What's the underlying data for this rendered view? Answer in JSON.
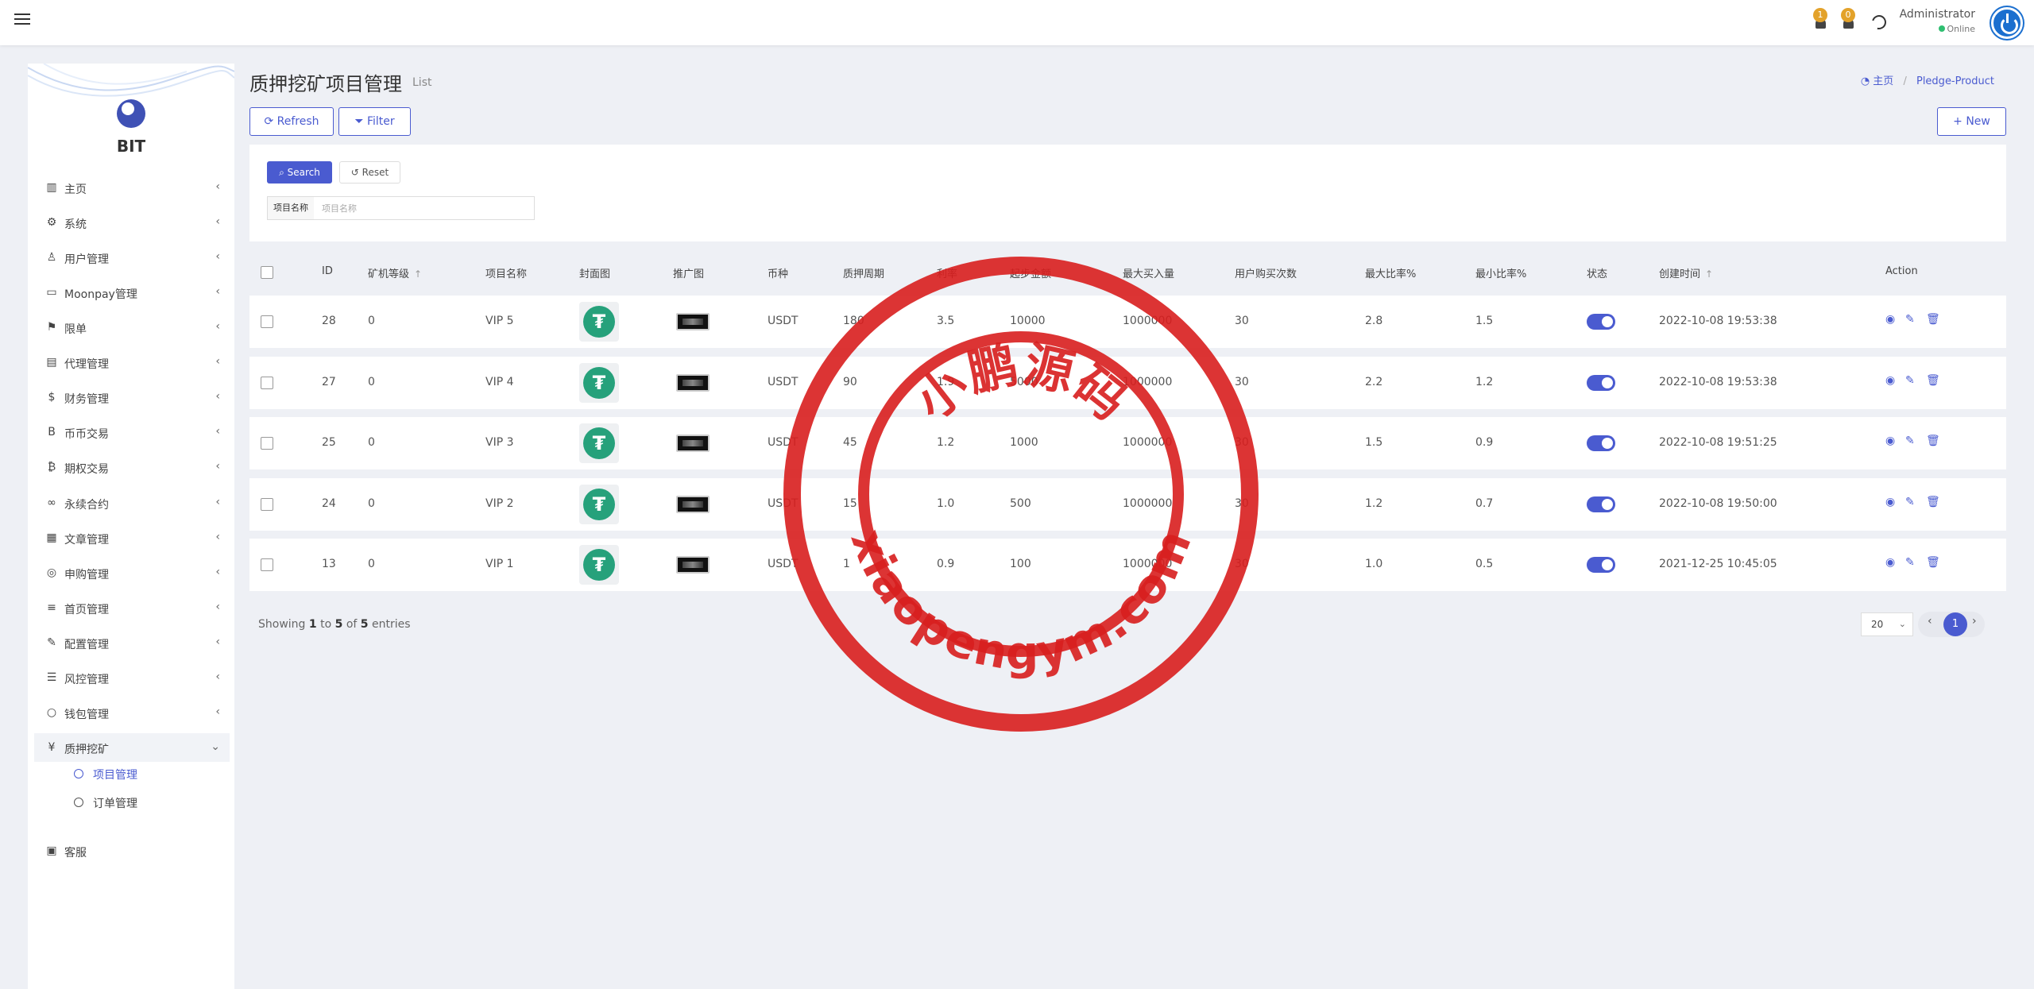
{
  "topbar": {
    "notifications": [
      {
        "icon": "bell-icon",
        "count": "1"
      },
      {
        "icon": "bell-icon",
        "count": "0"
      }
    ],
    "admin_name": "Administrator",
    "admin_status": "Online"
  },
  "sidebar": {
    "brand": "BIT",
    "items": [
      {
        "label": "主页",
        "icon": "bar-chart-icon",
        "glyph": "▥"
      },
      {
        "label": "系统",
        "icon": "gear-icon",
        "glyph": "⚙"
      },
      {
        "label": "用户管理",
        "icon": "user-icon",
        "glyph": "♙"
      },
      {
        "label": "Moonpay管理",
        "icon": "card-icon",
        "glyph": "▭"
      },
      {
        "label": "限单",
        "icon": "flag-icon",
        "glyph": "⚑"
      },
      {
        "label": "代理管理",
        "icon": "id-card-icon",
        "glyph": "▤"
      },
      {
        "label": "财务管理",
        "icon": "dollar-icon",
        "glyph": "$"
      },
      {
        "label": "币币交易",
        "icon": "bitcoin-icon",
        "glyph": "B"
      },
      {
        "label": "期权交易",
        "icon": "bitcoin-small-icon",
        "glyph": "₿"
      },
      {
        "label": "永续合约",
        "icon": "link-icon",
        "glyph": "∞"
      },
      {
        "label": "文章管理",
        "icon": "newspaper-icon",
        "glyph": "▦"
      },
      {
        "label": "申购管理",
        "icon": "lifebuoy-icon",
        "glyph": "◎"
      },
      {
        "label": "首页管理",
        "icon": "list-icon",
        "glyph": "≡"
      },
      {
        "label": "配置管理",
        "icon": "wrench-icon",
        "glyph": "✎"
      },
      {
        "label": "风控管理",
        "icon": "list-alt-icon",
        "glyph": "☰"
      },
      {
        "label": "钱包管理",
        "icon": "circle-icon",
        "glyph": "○"
      },
      {
        "label": "质押挖矿",
        "icon": "yen-icon",
        "glyph": "¥"
      }
    ],
    "sub_items": [
      {
        "label": "项目管理"
      },
      {
        "label": "订单管理"
      }
    ],
    "last_item": {
      "label": "客服",
      "icon": "contact-card-icon",
      "glyph": "▣"
    }
  },
  "page": {
    "title": "质押挖矿项目管理",
    "subtitle": "List",
    "breadcrumb_home": "主页",
    "breadcrumb_current": "Pledge-Product"
  },
  "toolbar": {
    "refresh_label": "Refresh",
    "filter_label": "Filter",
    "new_label": "New"
  },
  "filter": {
    "search_label": "Search",
    "reset_label": "Reset",
    "field_label": "项目名称",
    "field_placeholder": "项目名称",
    "field_value": ""
  },
  "table": {
    "headers": [
      "ID",
      "矿机等级",
      "项目名称",
      "封面图",
      "推广图",
      "币种",
      "质押周期",
      "利率",
      "起步金额",
      "最大买入量",
      "用户购买次数",
      "最大比率%",
      "最小比率%",
      "状态",
      "创建时间",
      "Action"
    ],
    "rows": [
      {
        "id": "28",
        "level": "0",
        "name": "VIP 5",
        "coin": "USDT",
        "period": "180",
        "rate": "3.5",
        "min": "10000",
        "max": "1000000",
        "times": "30",
        "max_ratio": "2.8",
        "min_ratio": "1.5",
        "status": true,
        "created": "2022-10-08 19:53:38"
      },
      {
        "id": "27",
        "level": "0",
        "name": "VIP 4",
        "coin": "USDT",
        "period": "90",
        "rate": "1.9",
        "min": "5000",
        "max": "1000000",
        "times": "30",
        "max_ratio": "2.2",
        "min_ratio": "1.2",
        "status": true,
        "created": "2022-10-08 19:53:38"
      },
      {
        "id": "25",
        "level": "0",
        "name": "VIP 3",
        "coin": "USDT",
        "period": "45",
        "rate": "1.2",
        "min": "1000",
        "max": "1000000",
        "times": "30",
        "max_ratio": "1.5",
        "min_ratio": "0.9",
        "status": true,
        "created": "2022-10-08 19:51:25"
      },
      {
        "id": "24",
        "level": "0",
        "name": "VIP 2",
        "coin": "USDT",
        "period": "15",
        "rate": "1.0",
        "min": "500",
        "max": "1000000",
        "times": "30",
        "max_ratio": "1.2",
        "min_ratio": "0.7",
        "status": true,
        "created": "2022-10-08 19:50:00"
      },
      {
        "id": "13",
        "level": "0",
        "name": "VIP 1",
        "coin": "USDT",
        "period": "1",
        "rate": "0.9",
        "min": "100",
        "max": "1000000",
        "times": "30",
        "max_ratio": "1.0",
        "min_ratio": "0.5",
        "status": true,
        "created": "2021-12-25 10:45:05"
      }
    ]
  },
  "pagination": {
    "showing_prefix": "Showing",
    "from": "1",
    "to_word": "to",
    "to": "5",
    "of_word": "of",
    "total": "5",
    "entries_word": "entries",
    "page_size": "20",
    "current_page": "1"
  },
  "watermark": {
    "text_top": "小鹏源码",
    "text_bottom": "xiaopengym.com",
    "color": "#d81e1e"
  },
  "colors": {
    "accent": "#4a5bd0",
    "tether": "#26a17b",
    "badge": "#e3a22a"
  }
}
